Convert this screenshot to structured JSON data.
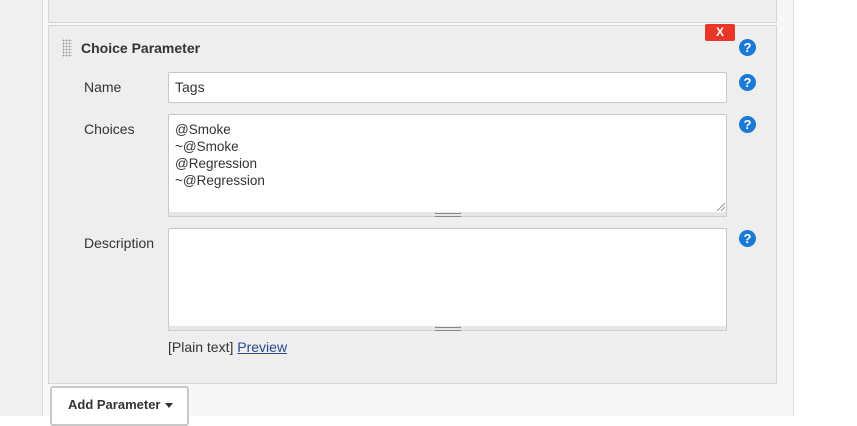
{
  "parameter": {
    "title": "Choice Parameter",
    "delete_label": "X",
    "help_label": "?",
    "fields": {
      "name": {
        "label": "Name",
        "value": "Tags"
      },
      "choices": {
        "label": "Choices",
        "lines": [
          "@Smoke",
          "~@Smoke",
          "@Regression",
          "~@Regression"
        ]
      },
      "description": {
        "label": "Description",
        "value": ""
      }
    },
    "format_hint": {
      "prefix": "[Plain text]",
      "preview_link": "Preview"
    }
  },
  "actions": {
    "add_parameter_label": "Add Parameter"
  },
  "colors": {
    "delete_bg": "#e8372a",
    "help_bg": "#1a7ad6",
    "link": "#2a4b8d"
  }
}
